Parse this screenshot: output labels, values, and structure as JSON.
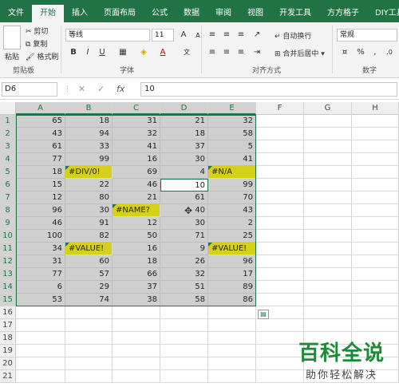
{
  "tabs": [
    "文件",
    "开始",
    "插入",
    "页面布局",
    "公式",
    "数据",
    "审阅",
    "视图",
    "开发工具",
    "方方格子",
    "DIY工具箱"
  ],
  "active_tab": 1,
  "ribbon": {
    "paste": "粘贴",
    "cut": "剪切",
    "copy": "复制",
    "format_painter": "格式刷",
    "clipboard_label": "剪贴板",
    "font_name": "等线",
    "font_size": "11",
    "grow_font": "A",
    "shrink_font": "A",
    "bold": "B",
    "italic": "I",
    "underline": "U",
    "font_label": "字体",
    "wrap_text": "自动换行",
    "merge_center": "合并后居中",
    "align_label": "对齐方式",
    "number_format": "常规",
    "percent": "%",
    "comma": ",",
    "number_label": "数字"
  },
  "formula_bar": {
    "name_box": "D6",
    "cancel": "✕",
    "enter": "✓",
    "fx": "fx",
    "value": "10"
  },
  "columns": [
    "A",
    "B",
    "C",
    "D",
    "E",
    "F",
    "G",
    "H"
  ],
  "rows": [
    "1",
    "2",
    "3",
    "4",
    "5",
    "6",
    "7",
    "8",
    "9",
    "10",
    "11",
    "12",
    "13",
    "14",
    "15",
    "16",
    "17",
    "18",
    "19",
    "20",
    "21"
  ],
  "cells": [
    [
      "65",
      "18",
      "31",
      "21",
      "32"
    ],
    [
      "43",
      "94",
      "32",
      "18",
      "58"
    ],
    [
      "61",
      "33",
      "41",
      "37",
      "5"
    ],
    [
      "77",
      "99",
      "16",
      "30",
      "41"
    ],
    [
      "18",
      "#DIV/0!",
      "69",
      "4",
      "#N/A"
    ],
    [
      "15",
      "22",
      "46",
      "10",
      "99"
    ],
    [
      "12",
      "80",
      "21",
      "61",
      "70"
    ],
    [
      "96",
      "30",
      "#NAME?",
      "40",
      "43"
    ],
    [
      "46",
      "91",
      "12",
      "30",
      "2"
    ],
    [
      "100",
      "82",
      "50",
      "71",
      "25"
    ],
    [
      "34",
      "#VALUE!",
      "16",
      "9",
      "#VALUE!"
    ],
    [
      "31",
      "60",
      "18",
      "26",
      "96"
    ],
    [
      "77",
      "57",
      "66",
      "32",
      "17"
    ],
    [
      "6",
      "29",
      "37",
      "51",
      "89"
    ],
    [
      "53",
      "74",
      "38",
      "58",
      "86"
    ]
  ],
  "colors": {
    "accent": "#217346",
    "range_fill": "#cfcfcf",
    "error_fill": "#d7d01a"
  },
  "watermark": {
    "title": "百科全说",
    "subtitle": "助你轻松解决"
  }
}
